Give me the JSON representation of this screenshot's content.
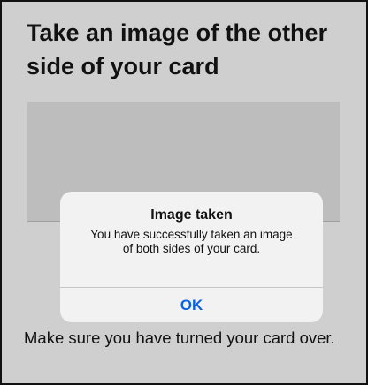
{
  "page": {
    "title": "Take an image of the other side of your card",
    "instruction": "Make sure you have turned your card over."
  },
  "alert": {
    "title": "Image taken",
    "message": "You have successfully taken an image of both sides of your card.",
    "ok_label": "OK"
  },
  "colors": {
    "background": "#cfcfcf",
    "preview_area": "#bdbdbd",
    "alert_background": "#f2f2f2",
    "button_blue": "#0a63e4"
  }
}
